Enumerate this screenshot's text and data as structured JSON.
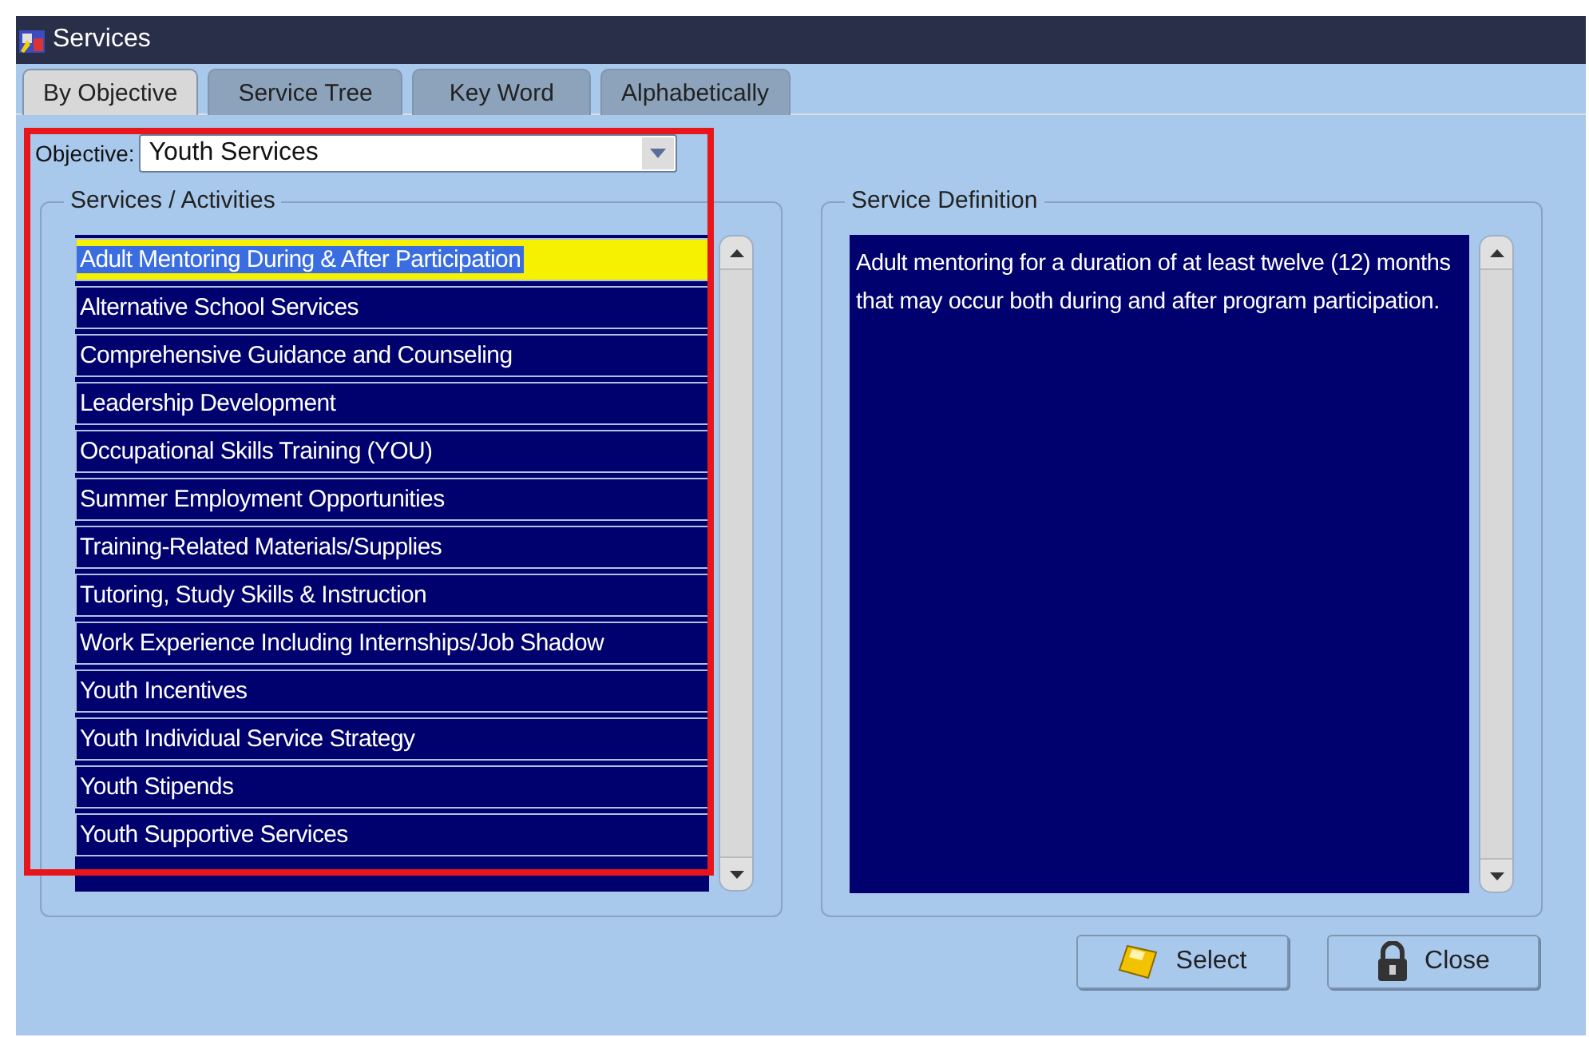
{
  "window": {
    "title": "Services"
  },
  "tabs": [
    {
      "label": "By Objective",
      "selected": true
    },
    {
      "label": "Service Tree",
      "selected": false
    },
    {
      "label": "Key Word",
      "selected": false
    },
    {
      "label": "Alphabetically",
      "selected": false
    }
  ],
  "objective": {
    "label": "Objective:",
    "value": "Youth Services"
  },
  "services": {
    "title": "Services / Activities",
    "items": [
      {
        "label": "Adult Mentoring During & After Participation",
        "selected": true
      },
      {
        "label": "Alternative School Services",
        "selected": false
      },
      {
        "label": "Comprehensive Guidance and Counseling",
        "selected": false
      },
      {
        "label": "Leadership Development",
        "selected": false
      },
      {
        "label": "Occupational Skills Training (YOU)",
        "selected": false
      },
      {
        "label": "Summer Employment Opportunities",
        "selected": false
      },
      {
        "label": "Training-Related Materials/Supplies",
        "selected": false
      },
      {
        "label": "Tutoring, Study Skills & Instruction",
        "selected": false
      },
      {
        "label": "Work Experience Including Internships/Job Shadow",
        "selected": false
      },
      {
        "label": "Youth Incentives",
        "selected": false
      },
      {
        "label": "Youth Individual Service Strategy",
        "selected": false
      },
      {
        "label": "Youth Stipends",
        "selected": false
      },
      {
        "label": "Youth Supportive Services",
        "selected": false
      }
    ]
  },
  "definition": {
    "title": "Service Definition",
    "text": "Adult mentoring for a duration of at least twelve (12) months that may occur both during and after program participation."
  },
  "buttons": [
    {
      "kind": "select",
      "label": "Select"
    },
    {
      "kind": "close",
      "label": "Close"
    }
  ]
}
